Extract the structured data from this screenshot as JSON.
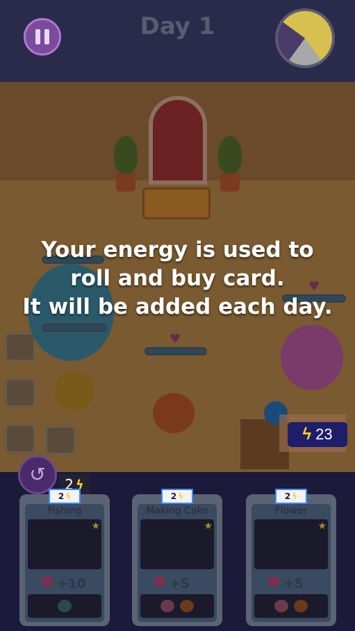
{
  "header": {
    "day_label": "Day 1"
  },
  "overlay": {
    "lines": [
      "Your energy is used to",
      "roll and buy card.",
      "It will be added each day."
    ]
  },
  "energy": {
    "value": "23",
    "icon": "lightning-bolt-icon"
  },
  "roll": {
    "cost": "2",
    "icon": "undo-arrow-icon"
  },
  "cards": [
    {
      "name": "Fishing",
      "cost": "2",
      "reward": "+10",
      "art_icon": "fish-icon"
    },
    {
      "name": "Making Cake",
      "cost": "2",
      "reward": "+5",
      "art_icon": "rolling-pin-icon"
    },
    {
      "name": "Flower",
      "cost": "2",
      "reward": "+5",
      "art_icon": "rose-icon"
    }
  ],
  "colors": {
    "energy_box": "#1e1e6a",
    "bolt": "#ffd21a",
    "overlay_text": "#ffffff"
  }
}
